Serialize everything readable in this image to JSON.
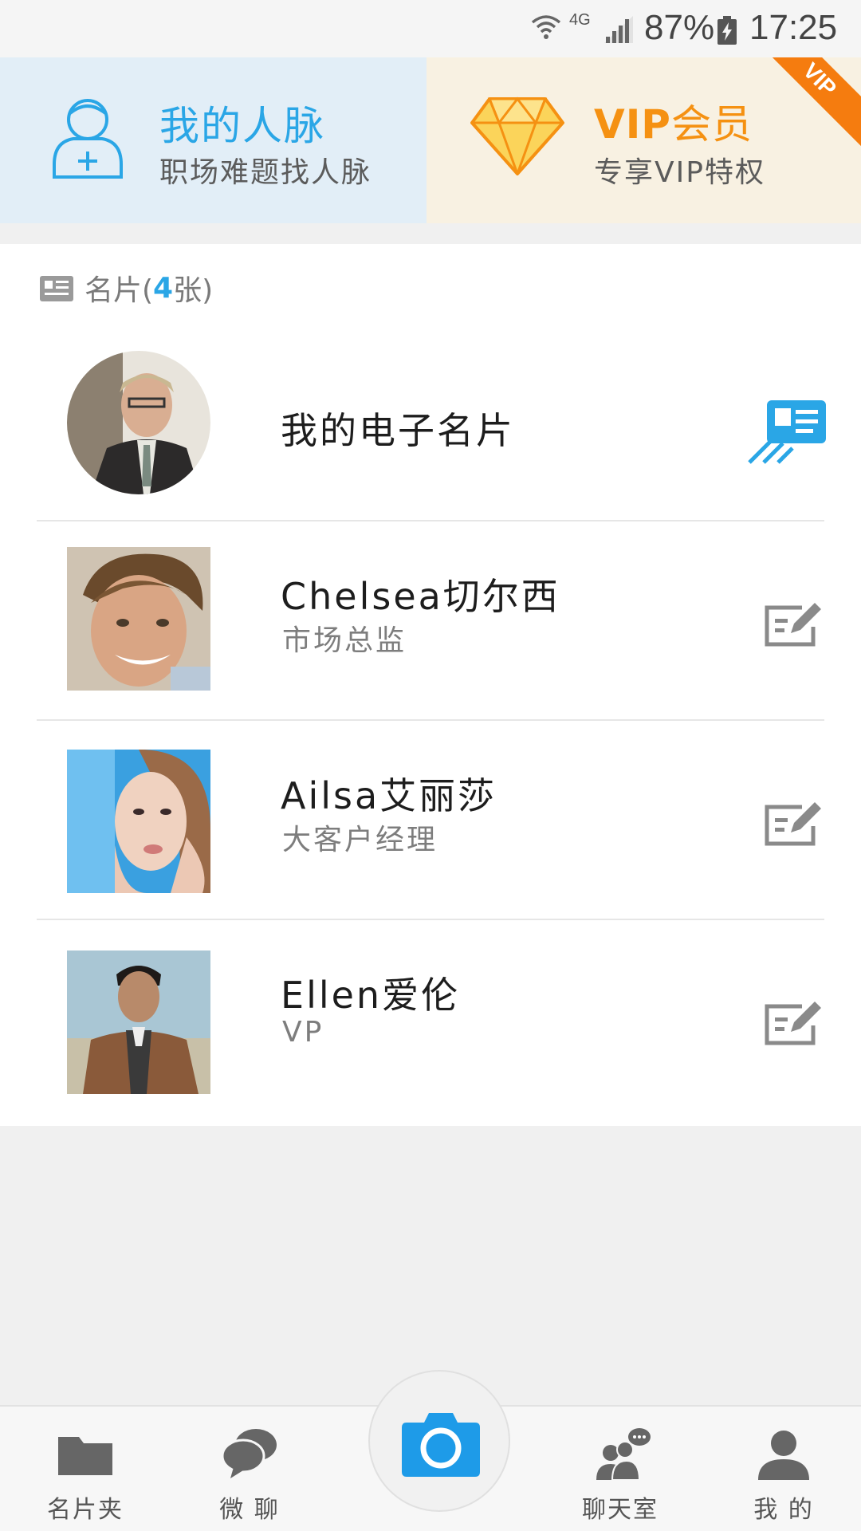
{
  "status_bar": {
    "network": "4G",
    "battery": "87%",
    "time": "17:25",
    "icons": [
      "wifi-icon",
      "signal-icon",
      "battery-charging-icon"
    ]
  },
  "banners": {
    "contacts": {
      "title": "我的人脉",
      "subtitle": "职场难题找人脉",
      "icon": "contacts-add-icon"
    },
    "vip": {
      "title_latin": "VIP",
      "title_cn": "会员",
      "subtitle": "专享VIP特权",
      "ribbon": "VIP",
      "icon": "diamond-icon"
    }
  },
  "cards": {
    "header_prefix": "名片(",
    "count": "4",
    "header_suffix": "张)",
    "items": [
      {
        "name": "我的电子名片",
        "title": "",
        "action": "business-card-share-icon"
      },
      {
        "name": "Chelsea切尔西",
        "title": "市场总监",
        "action": "edit-icon"
      },
      {
        "name": "Ailsa艾丽莎",
        "title": "大客户经理",
        "action": "edit-icon"
      },
      {
        "name": "Ellen爱伦",
        "title": "VP",
        "action": "edit-icon"
      }
    ]
  },
  "bottom_nav": {
    "items": [
      {
        "label": "名片夹",
        "icon": "folder-icon"
      },
      {
        "label": "微 聊",
        "icon": "chat-bubbles-icon"
      },
      {
        "label": "",
        "icon": "camera-icon"
      },
      {
        "label": "聊天室",
        "icon": "chatroom-icon"
      },
      {
        "label": "我 的",
        "icon": "profile-icon"
      }
    ]
  },
  "colors": {
    "accent_blue": "#2aa6e6",
    "accent_orange": "#f59112",
    "banner_blue_bg": "#e2eef7",
    "banner_cream_bg": "#f8f1e2",
    "camera_blue": "#1e9be8"
  }
}
